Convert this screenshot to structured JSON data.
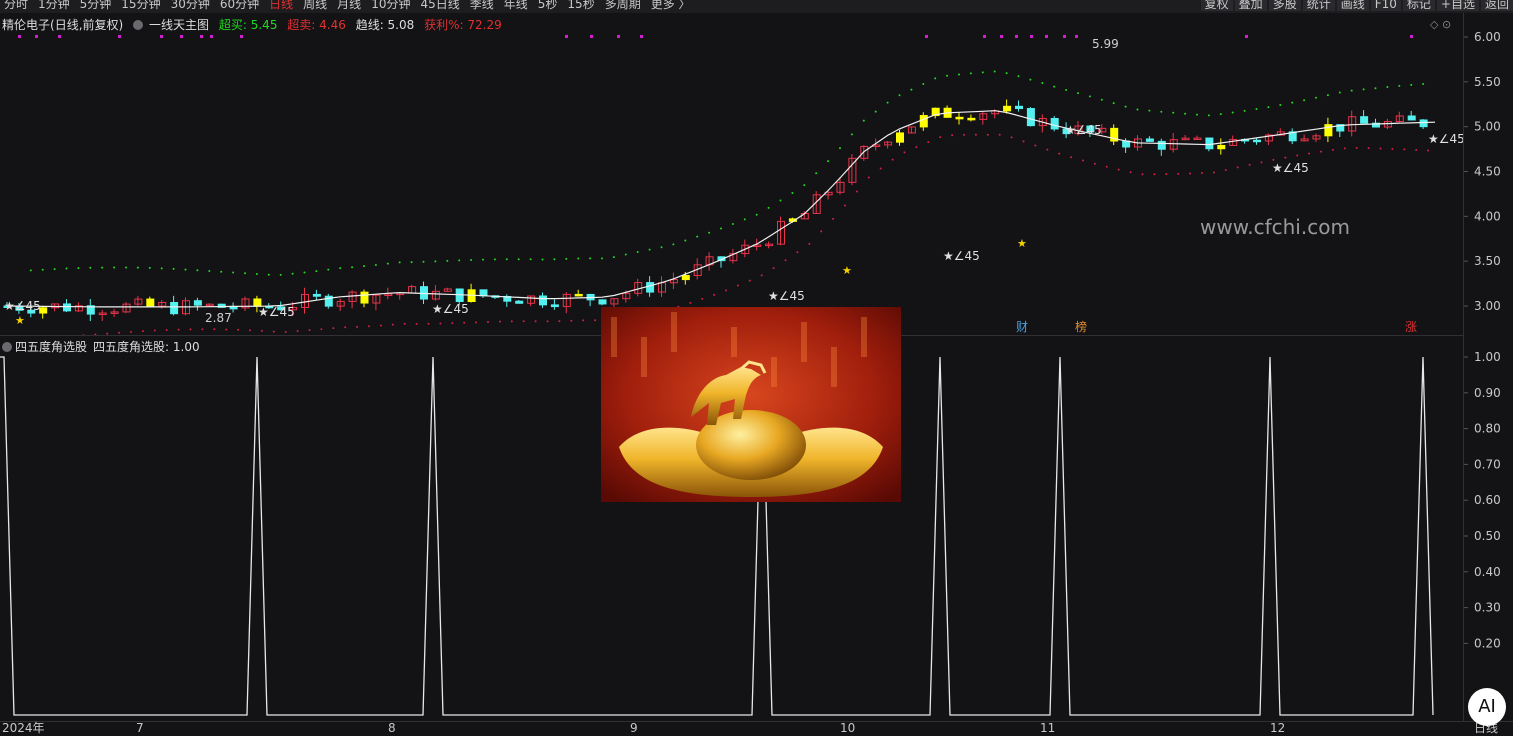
{
  "topbar": {
    "periods": [
      "分时",
      "1分钟",
      "5分钟",
      "15分钟",
      "30分钟",
      "60分钟",
      "日线",
      "周线",
      "月线",
      "10分钟",
      "45日线",
      "季线",
      "年线",
      "5秒",
      "15秒",
      "多周期",
      "更多 〉"
    ],
    "active_period": "日线",
    "right_buttons": [
      "复权",
      "叠加",
      "多股",
      "统计",
      "画线",
      "F10",
      "标记",
      "+自选",
      "返回"
    ]
  },
  "main_info": {
    "stock": "精伦电子",
    "mode": "(日线,前复权)",
    "indicator": "一线天主图",
    "buy_label": "超买: 5.45",
    "sell_label": "超卖: 4.46",
    "trend_label": "趋线: 5.08",
    "profit_label": "获利%: 72.29"
  },
  "sub_info": {
    "indicator": "四五度角选股",
    "value_label": "四五度角选股: 1.00"
  },
  "watermark": "www.cfchi.com",
  "period_badge": "日线",
  "ai_label": "AI",
  "chart_data": [
    {
      "type": "candlestick",
      "title": "精伦电子 (日线,前复权)",
      "y_ticks": [
        "6.00",
        "5.50",
        "5.00",
        "4.50",
        "4.00",
        "3.50",
        "3.00"
      ],
      "ylim": [
        2.75,
        6.1
      ],
      "x_labels": [
        "2024年",
        "7",
        "8",
        "9",
        "10",
        "11",
        "12"
      ],
      "annotations": [
        "5.99",
        "2.87",
        "∠45",
        "财",
        "榜",
        "涨"
      ],
      "series": [
        {
          "name": "趋线",
          "value": 5.08
        },
        {
          "name": "超买",
          "value": 5.45
        },
        {
          "name": "超卖",
          "value": 4.46
        }
      ]
    },
    {
      "type": "line",
      "title": "四五度角选股",
      "y_ticks": [
        "1.00",
        "0.90",
        "0.80",
        "0.70",
        "0.60",
        "0.50",
        "0.40",
        "0.30",
        "0.20"
      ],
      "ylim": [
        0.0,
        1.05
      ],
      "signal_days": [
        0,
        128,
        217,
        321,
        382,
        473,
        535,
        677,
        762
      ]
    }
  ],
  "colors": {
    "up": "#e8334a",
    "down": "#54f0f0",
    "signal": "#ffff00",
    "accent_red": "#e03030",
    "buy_green": "#22d822"
  }
}
